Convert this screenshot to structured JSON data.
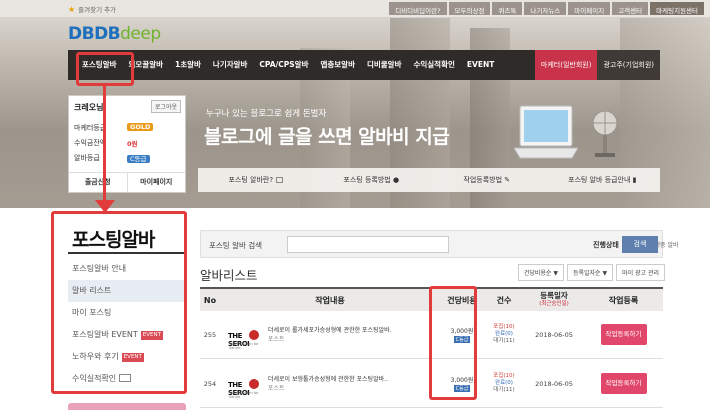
{
  "topbar": {
    "favorite_label": "즐겨찾기 추가",
    "links": [
      "디비디비딥이란?",
      "모두의상점",
      "퀴즈톡",
      "나기자뉴스",
      "마이페이지",
      "고객센터",
      "마케팅지원센터"
    ]
  },
  "logo": {
    "part1": "DBDB",
    "part2": "deep"
  },
  "nav": {
    "items": [
      "포스팅알바",
      "외모꿀알바",
      "1초알바",
      "나기자알바",
      "CPA/CPS알바",
      "앱충보알바",
      "디비쿨알바",
      "수익실적확인",
      "EVENT"
    ],
    "marketer_btn": "마케터(일반회원)",
    "advertiser_btn": "광고주(기업회원)"
  },
  "login": {
    "name": "크레오님",
    "logout": "로그아웃",
    "rows": [
      {
        "label": "마케터등급",
        "value": "GOLD"
      },
      {
        "label": "수익금잔액",
        "value": "0원"
      },
      {
        "label": "알바등급",
        "value": "C등급"
      }
    ],
    "withdraw_btn": "출금신청",
    "mypage_btn": "마이페이지"
  },
  "banner": {
    "subtitle": "누구나 있는 블로그로 쉽게 돈벌자",
    "title": "블로그에 글을 쓰면 알바비 지급",
    "menu": [
      "포스팅 알바란?",
      "포스팅 등록방법",
      "작업등록방법",
      "포스팅 알바 등급안내"
    ]
  },
  "sidebar": {
    "title": "포스팅알바",
    "items": [
      {
        "label": "포스팅알바 안내",
        "badge": ""
      },
      {
        "label": "알바 리스트",
        "badge": ""
      },
      {
        "label": "마이 포스팅",
        "badge": ""
      },
      {
        "label": "포스팅알바 EVENT",
        "badge": "EVENT"
      },
      {
        "label": "노하우와 후기",
        "badge": "EVENT"
      },
      {
        "label": "수익실적확인",
        "badge": ""
      }
    ]
  },
  "search": {
    "label": "포스팅 알바 검색",
    "value": "",
    "status_label": "진행상태",
    "checkbox_label": "진행중 알바",
    "button": "검색"
  },
  "list": {
    "title": "알바리스트",
    "sort_buttons": [
      "건당비용순 ▼",
      "등록일자순 ▼",
      "마이 광고 관리"
    ],
    "columns": {
      "no": "No",
      "job": "작업내용",
      "fee": "건당비용",
      "count": "건수",
      "date": "등록일자",
      "date_note": "(최근승인일)",
      "reg": "작업등록"
    },
    "rows": [
      {
        "no": "255",
        "logo_main": "THE SEROI",
        "logo_sub": "Total Solution for Senior",
        "title": "더세로이 롤가세포가승성형에 관한한 포스팅알바.",
        "category": "포스트",
        "fee": "3,000원",
        "pay": "C등급",
        "cnt1": "포집(10)",
        "cnt2": "완료(0)",
        "cnt3": "대기(11)",
        "date": "2018-06-05",
        "btn": "작업등록하기"
      },
      {
        "no": "254",
        "logo_main": "THE SEROI",
        "logo_sub": "Total Solution for Senior",
        "title": "더세로이 보형툴가승성형에 관한한 포스팅알바..",
        "category": "포스트",
        "fee": "3,000원",
        "pay": "C등급",
        "cnt1": "포집(10)",
        "cnt2": "완료(0)",
        "cnt3": "대기(11)",
        "date": "2018-06-05",
        "btn": "작업등록하기"
      }
    ]
  },
  "colors": {
    "accent_red": "#e23b3b",
    "nav_dark": "#2f2b28",
    "button_pink": "#e0476a",
    "search_blue": "#5f7fae"
  }
}
